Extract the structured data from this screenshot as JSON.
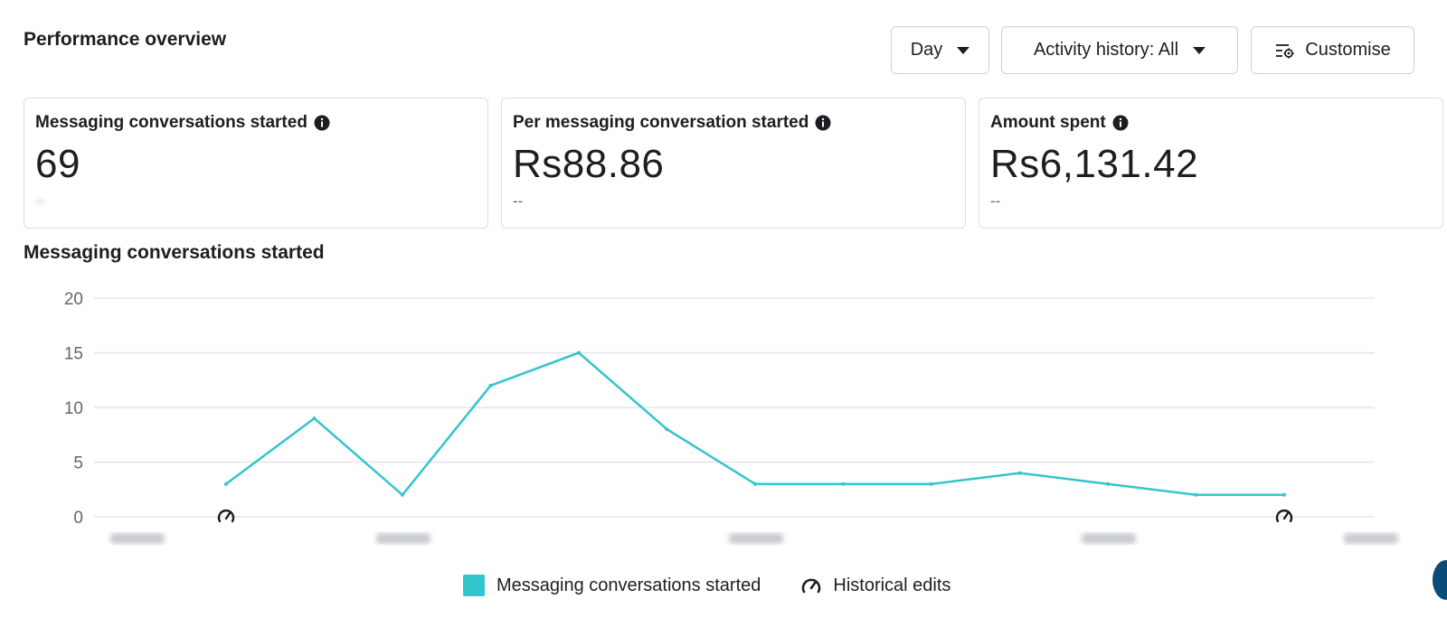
{
  "header": {
    "title": "Performance overview",
    "day_button": "Day",
    "activity_button": "Activity history: All",
    "customise_button": "Customise"
  },
  "cards": [
    {
      "label": "Messaging conversations started",
      "value": "69",
      "sub": "--"
    },
    {
      "label": "Per messaging conversation started",
      "value": "Rs88.86",
      "sub": "--"
    },
    {
      "label": "Amount spent",
      "value": "Rs6,131.42",
      "sub": "--"
    }
  ],
  "colors": {
    "series": "#33c5cc",
    "grid": "#e4e6eb",
    "text": "#1c1e21",
    "border": "#dadde1"
  },
  "icons": {
    "info": "info-circle-icon",
    "caret": "caret-down-icon",
    "customise": "sliders-gear-icon",
    "historical_edit": "gauge-edit-icon"
  },
  "chart_data": {
    "type": "line",
    "title": "Messaging conversations started",
    "y_ticks": [
      "20",
      "15",
      "10",
      "5",
      "0"
    ],
    "ylim": [
      0,
      20
    ],
    "grid": true,
    "series": [
      {
        "name": "Messaging conversations started",
        "values": [
          3,
          9,
          2,
          12,
          15,
          8,
          3,
          3,
          3,
          4,
          3,
          2,
          2
        ]
      }
    ],
    "historical_edit_points": [
      0,
      12
    ],
    "legend": [
      "Messaging conversations started",
      "Historical edits"
    ],
    "legend_position": "bottom"
  }
}
